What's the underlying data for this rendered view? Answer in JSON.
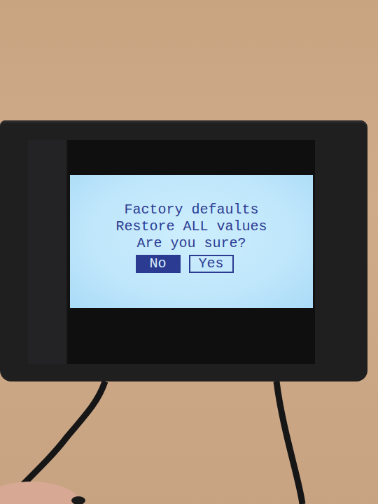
{
  "screen": {
    "lines": [
      "Factory defaults",
      "Restore ALL values",
      "Are you sure?"
    ],
    "buttons": [
      {
        "label": "No",
        "selected": true
      },
      {
        "label": "Yes",
        "selected": false
      }
    ]
  }
}
